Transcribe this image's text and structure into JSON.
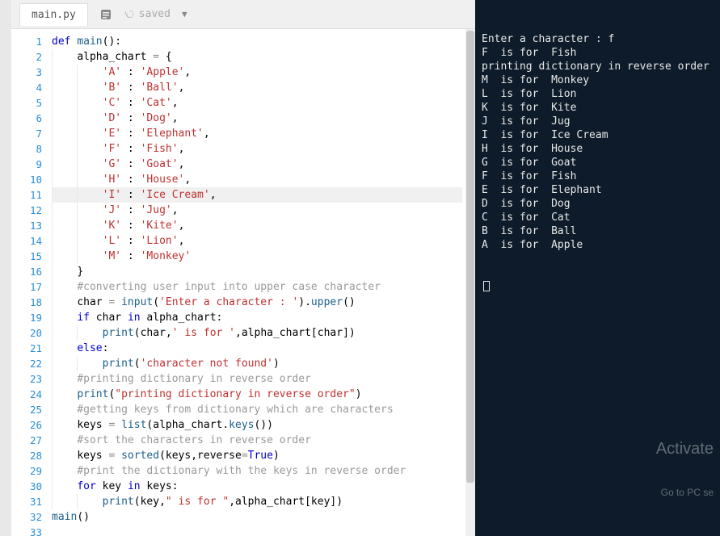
{
  "header": {
    "tab": "main.py",
    "saved_label": "saved"
  },
  "highlight_line": 11,
  "code": [
    {
      "n": 1,
      "indent": 0,
      "tokens": [
        {
          "t": "def ",
          "c": "tok-kw"
        },
        {
          "t": "main",
          "c": "tok-fn"
        },
        {
          "t": "():"
        }
      ]
    },
    {
      "n": 2,
      "indent": 1,
      "tokens": [
        {
          "t": "alpha_chart "
        },
        {
          "t": "=",
          "c": "tok-op"
        },
        {
          "t": " {"
        }
      ]
    },
    {
      "n": 3,
      "indent": 2,
      "tokens": [
        {
          "t": "'A'",
          "c": "tok-str"
        },
        {
          "t": " : "
        },
        {
          "t": "'Apple'",
          "c": "tok-str"
        },
        {
          "t": ","
        }
      ]
    },
    {
      "n": 4,
      "indent": 2,
      "tokens": [
        {
          "t": "'B'",
          "c": "tok-str"
        },
        {
          "t": " : "
        },
        {
          "t": "'Ball'",
          "c": "tok-str"
        },
        {
          "t": ","
        }
      ]
    },
    {
      "n": 5,
      "indent": 2,
      "tokens": [
        {
          "t": "'C'",
          "c": "tok-str"
        },
        {
          "t": " : "
        },
        {
          "t": "'Cat'",
          "c": "tok-str"
        },
        {
          "t": ","
        }
      ]
    },
    {
      "n": 6,
      "indent": 2,
      "tokens": [
        {
          "t": "'D'",
          "c": "tok-str"
        },
        {
          "t": " : "
        },
        {
          "t": "'Dog'",
          "c": "tok-str"
        },
        {
          "t": ","
        }
      ]
    },
    {
      "n": 7,
      "indent": 2,
      "tokens": [
        {
          "t": "'E'",
          "c": "tok-str"
        },
        {
          "t": " : "
        },
        {
          "t": "'Elephant'",
          "c": "tok-str"
        },
        {
          "t": ","
        }
      ]
    },
    {
      "n": 8,
      "indent": 2,
      "tokens": [
        {
          "t": "'F'",
          "c": "tok-str"
        },
        {
          "t": " : "
        },
        {
          "t": "'Fish'",
          "c": "tok-str"
        },
        {
          "t": ","
        }
      ]
    },
    {
      "n": 9,
      "indent": 2,
      "tokens": [
        {
          "t": "'G'",
          "c": "tok-str"
        },
        {
          "t": " : "
        },
        {
          "t": "'Goat'",
          "c": "tok-str"
        },
        {
          "t": ","
        }
      ]
    },
    {
      "n": 10,
      "indent": 2,
      "tokens": [
        {
          "t": "'H'",
          "c": "tok-str"
        },
        {
          "t": " : "
        },
        {
          "t": "'House'",
          "c": "tok-str"
        },
        {
          "t": ","
        }
      ]
    },
    {
      "n": 11,
      "indent": 2,
      "tokens": [
        {
          "t": "'I'",
          "c": "tok-str"
        },
        {
          "t": " : "
        },
        {
          "t": "'Ice Cream'",
          "c": "tok-str"
        },
        {
          "t": ","
        }
      ]
    },
    {
      "n": 12,
      "indent": 2,
      "tokens": [
        {
          "t": "'J'",
          "c": "tok-str"
        },
        {
          "t": " : "
        },
        {
          "t": "'Jug'",
          "c": "tok-str"
        },
        {
          "t": ","
        }
      ]
    },
    {
      "n": 13,
      "indent": 2,
      "tokens": [
        {
          "t": "'K'",
          "c": "tok-str"
        },
        {
          "t": " : "
        },
        {
          "t": "'Kite'",
          "c": "tok-str"
        },
        {
          "t": ","
        }
      ]
    },
    {
      "n": 14,
      "indent": 2,
      "tokens": [
        {
          "t": "'L'",
          "c": "tok-str"
        },
        {
          "t": " : "
        },
        {
          "t": "'Lion'",
          "c": "tok-str"
        },
        {
          "t": ","
        }
      ]
    },
    {
      "n": 15,
      "indent": 2,
      "tokens": [
        {
          "t": "'M'",
          "c": "tok-str"
        },
        {
          "t": " : "
        },
        {
          "t": "'Monkey'",
          "c": "tok-str"
        }
      ]
    },
    {
      "n": 16,
      "indent": 1,
      "tokens": [
        {
          "t": "}"
        }
      ]
    },
    {
      "n": 17,
      "indent": 1,
      "tokens": [
        {
          "t": "#converting user input into upper case character",
          "c": "tok-cmt"
        }
      ]
    },
    {
      "n": 18,
      "indent": 1,
      "tokens": [
        {
          "t": "char "
        },
        {
          "t": "=",
          "c": "tok-op"
        },
        {
          "t": " "
        },
        {
          "t": "input",
          "c": "tok-fn"
        },
        {
          "t": "("
        },
        {
          "t": "'Enter a character : '",
          "c": "tok-str"
        },
        {
          "t": ")."
        },
        {
          "t": "upper",
          "c": "tok-fn"
        },
        {
          "t": "()"
        }
      ]
    },
    {
      "n": 19,
      "indent": 1,
      "tokens": [
        {
          "t": "if ",
          "c": "tok-kw"
        },
        {
          "t": "char "
        },
        {
          "t": "in ",
          "c": "tok-kw"
        },
        {
          "t": "alpha_chart:"
        }
      ]
    },
    {
      "n": 20,
      "indent": 2,
      "tokens": [
        {
          "t": "print",
          "c": "tok-fn"
        },
        {
          "t": "(char,"
        },
        {
          "t": "' is for '",
          "c": "tok-str"
        },
        {
          "t": ",alpha_chart[char])"
        }
      ]
    },
    {
      "n": 21,
      "indent": 1,
      "tokens": [
        {
          "t": "else",
          "c": "tok-kw"
        },
        {
          "t": ":"
        }
      ]
    },
    {
      "n": 22,
      "indent": 2,
      "tokens": [
        {
          "t": "print",
          "c": "tok-fn"
        },
        {
          "t": "("
        },
        {
          "t": "'character not found'",
          "c": "tok-str"
        },
        {
          "t": ")"
        }
      ]
    },
    {
      "n": 23,
      "indent": 1,
      "tokens": [
        {
          "t": "#printing dictionary in reverse order",
          "c": "tok-cmt"
        }
      ]
    },
    {
      "n": 24,
      "indent": 1,
      "tokens": [
        {
          "t": "print",
          "c": "tok-fn"
        },
        {
          "t": "("
        },
        {
          "t": "\"printing dictionary in reverse order\"",
          "c": "tok-str"
        },
        {
          "t": ")"
        }
      ]
    },
    {
      "n": 25,
      "indent": 1,
      "tokens": [
        {
          "t": "#getting keys from dictionary which are characters",
          "c": "tok-cmt"
        }
      ]
    },
    {
      "n": 26,
      "indent": 1,
      "tokens": [
        {
          "t": "keys "
        },
        {
          "t": "=",
          "c": "tok-op"
        },
        {
          "t": " "
        },
        {
          "t": "list",
          "c": "tok-fn"
        },
        {
          "t": "(alpha_chart."
        },
        {
          "t": "keys",
          "c": "tok-fn"
        },
        {
          "t": "())"
        }
      ]
    },
    {
      "n": 27,
      "indent": 1,
      "tokens": [
        {
          "t": "#sort the characters in reverse order",
          "c": "tok-cmt"
        }
      ]
    },
    {
      "n": 28,
      "indent": 1,
      "tokens": [
        {
          "t": "keys "
        },
        {
          "t": "=",
          "c": "tok-op"
        },
        {
          "t": " "
        },
        {
          "t": "sorted",
          "c": "tok-fn"
        },
        {
          "t": "(keys,reverse"
        },
        {
          "t": "=",
          "c": "tok-op"
        },
        {
          "t": "True",
          "c": "tok-kw"
        },
        {
          "t": ")"
        }
      ]
    },
    {
      "n": 29,
      "indent": 1,
      "tokens": [
        {
          "t": "#print the dictionary with the keys in reverse order",
          "c": "tok-cmt"
        }
      ]
    },
    {
      "n": 30,
      "indent": 1,
      "tokens": [
        {
          "t": "for ",
          "c": "tok-kw"
        },
        {
          "t": "key "
        },
        {
          "t": "in ",
          "c": "tok-kw"
        },
        {
          "t": "keys:"
        }
      ]
    },
    {
      "n": 31,
      "indent": 2,
      "tokens": [
        {
          "t": "print",
          "c": "tok-fn"
        },
        {
          "t": "(key,"
        },
        {
          "t": "\" is for \"",
          "c": "tok-str"
        },
        {
          "t": ",alpha_chart[key])"
        }
      ]
    },
    {
      "n": 32,
      "indent": 0,
      "tokens": [
        {
          "t": "main",
          "c": "tok-fn"
        },
        {
          "t": "()"
        }
      ]
    },
    {
      "n": 33,
      "indent": 0,
      "tokens": []
    }
  ],
  "terminal": {
    "lines": [
      "Enter a character : f",
      "F  is for  Fish",
      "printing dictionary in reverse order",
      "M  is for  Monkey",
      "L  is for  Lion",
      "K  is for  Kite",
      "J  is for  Jug",
      "I  is for  Ice Cream",
      "H  is for  House",
      "G  is for  Goat",
      "F  is for  Fish",
      "E  is for  Elephant",
      "D  is for  Dog",
      "C  is for  Cat",
      "B  is for  Ball",
      "A  is for  Apple"
    ],
    "prompt_symbol": ""
  },
  "watermark": {
    "line1": "Activate",
    "line2": "Go to PC se"
  }
}
